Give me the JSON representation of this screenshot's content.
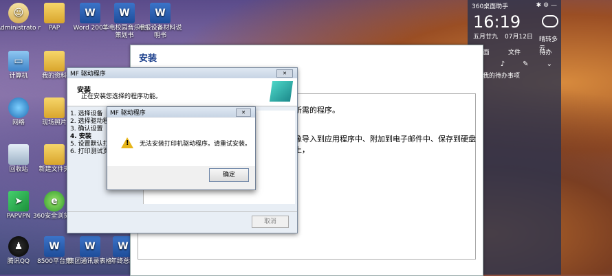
{
  "desktop_icons": [
    {
      "label": "Administrato r",
      "type": "person"
    },
    {
      "label": "PAP",
      "type": "folder"
    },
    {
      "label": "Word 2007",
      "type": "word"
    },
    {
      "label": "华电校园音乐会策划书",
      "type": "word"
    },
    {
      "label": "申报设备材料说明书",
      "type": "word"
    },
    {
      "label": "计算机",
      "type": "pc"
    },
    {
      "label": "我的资料",
      "type": "folder"
    },
    {
      "label": "网络",
      "type": "globe"
    },
    {
      "label": "现场照片",
      "type": "folder"
    },
    {
      "label": "回收站",
      "type": "bin"
    },
    {
      "label": "新建文件夹",
      "type": "folder"
    },
    {
      "label": "PAPVPN",
      "type": "arrow"
    },
    {
      "label": "360安全浏览器",
      "type": "green"
    },
    {
      "label": "腾讯QQ",
      "type": "qq"
    },
    {
      "label": "8500平台集",
      "type": "word"
    },
    {
      "label": "集团通讯录表格",
      "type": "word"
    },
    {
      "label": "年终总结",
      "type": "word"
    }
  ],
  "gadget": {
    "name": "360桌面助手",
    "time": "16:19",
    "date1": "五月廿九",
    "date2": "07月12日",
    "weather": "晴转多云",
    "tools": [
      "桌面",
      "文件",
      "待办"
    ],
    "row3": "我的待办事项"
  },
  "big_window": {
    "title": "安装",
    "text1": "所需的程序。",
    "text2": "像导入到应用程序中、附加到电子邮件中、保存到硬盘上，"
  },
  "mf_window": {
    "title": "MF 驱动程序",
    "header_title": "安装",
    "header_sub": "正在安装您选择的程序功能。",
    "steps": [
      "1. 选择设备",
      "2. 选择驱动程",
      "3. 确认设置",
      "4. 安装",
      "5. 设置默认打",
      "6. 打印测试页"
    ],
    "cancel": "取消"
  },
  "error_dialog": {
    "title": "MF 驱动程序",
    "message": "无法安装打印机驱动程序。请重试安装。",
    "ok": "确定"
  }
}
